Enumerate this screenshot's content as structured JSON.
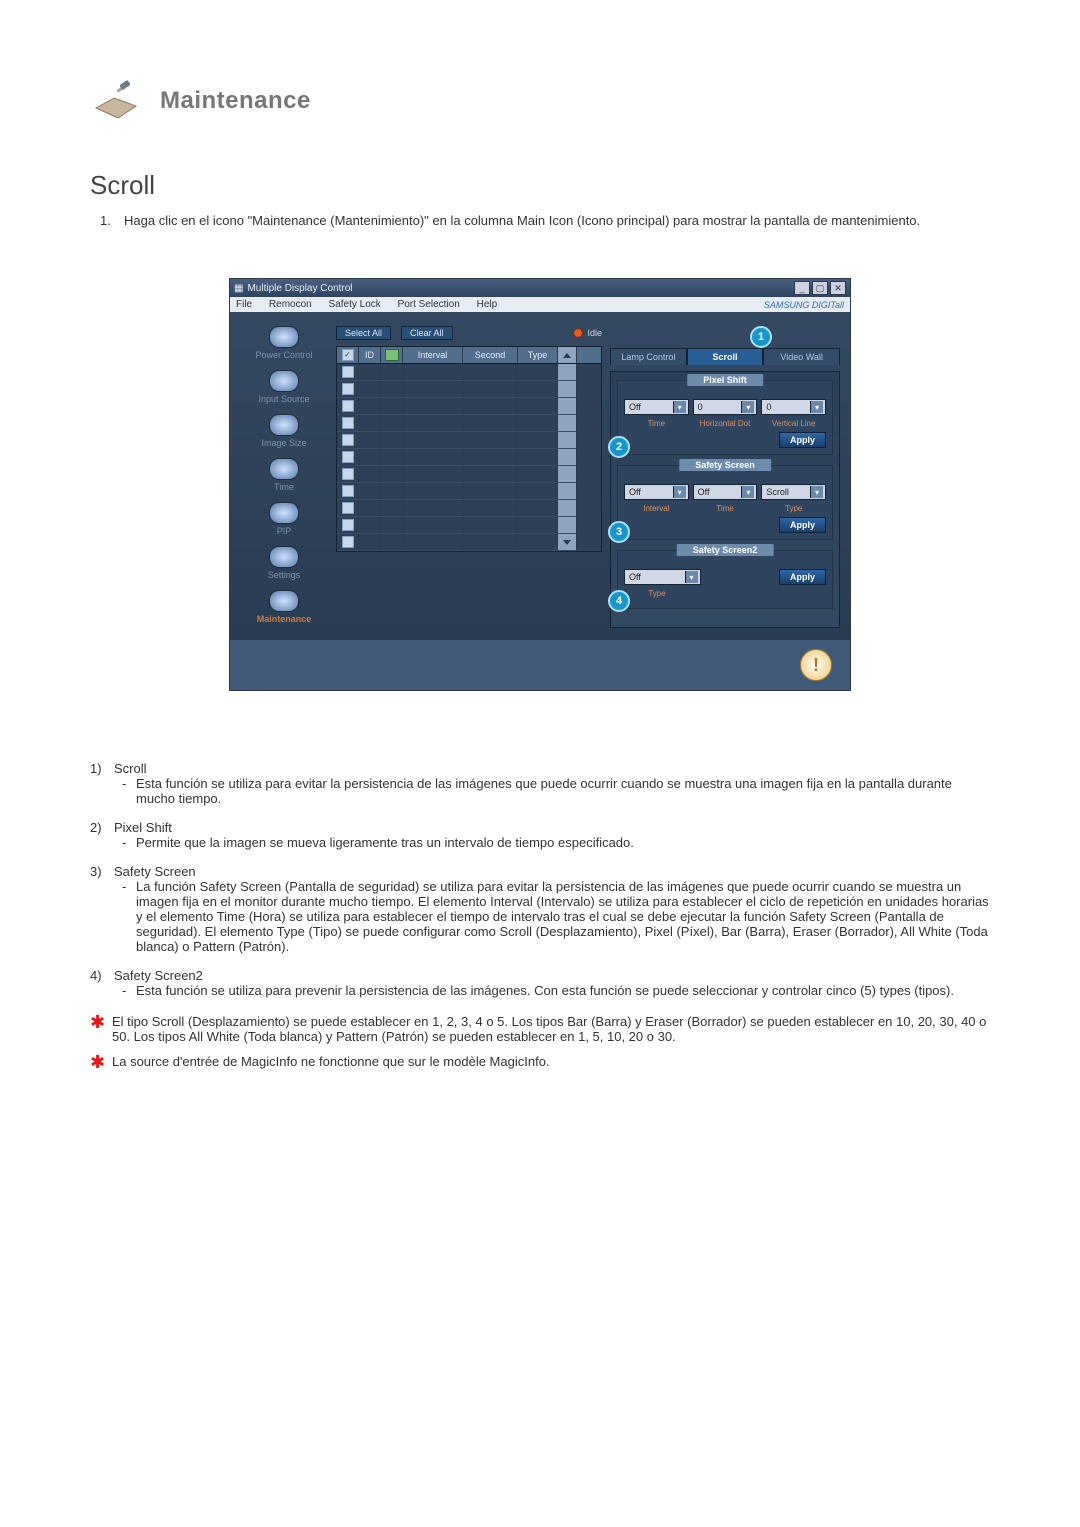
{
  "title": "Maintenance",
  "section": "Scroll",
  "intro": {
    "num": "1.",
    "text": "Haga clic en el icono \"Maintenance (Mantenimiento)\" en la columna Main Icon (Icono principal) para mostrar la pantalla de mantenimiento."
  },
  "window": {
    "title": "Multiple Display Control",
    "menu": [
      "File",
      "Remocon",
      "Safety Lock",
      "Port Selection",
      "Help"
    ],
    "brand": "SAMSUNG DIGITall"
  },
  "sidebar": [
    {
      "label": "Power Control"
    },
    {
      "label": "Input Source"
    },
    {
      "label": "Image Size"
    },
    {
      "label": "Time"
    },
    {
      "label": "PIP"
    },
    {
      "label": "Settings"
    },
    {
      "label": "Maintenance"
    }
  ],
  "mid": {
    "select_all": "Select All",
    "clear_all": "Clear All",
    "idle": "Idle",
    "headers": {
      "id": "ID",
      "interval": "Interval",
      "second": "Second",
      "type": "Type"
    }
  },
  "tabs": {
    "lamp": "Lamp Control",
    "scroll": "Scroll",
    "video": "Video Wall"
  },
  "callouts": {
    "one": "1",
    "two": "2",
    "three": "3",
    "four": "4"
  },
  "pixel_shift": {
    "title": "Pixel Shift",
    "time": "Off",
    "hdot": "0",
    "vline": "0",
    "sub_time": "Time",
    "sub_hdot": "Horizontal Dot",
    "sub_vline": "Vertical Line",
    "apply": "Apply"
  },
  "safety_screen": {
    "title": "Safety Screen",
    "interval": "Off",
    "time": "Off",
    "type": "Scroll",
    "sub_interval": "Interval",
    "sub_time": "Time",
    "sub_type": "Type",
    "apply": "Apply"
  },
  "safety_screen2": {
    "title": "Safety Screen2",
    "type": "Off",
    "sub_type": "Type",
    "apply": "Apply"
  },
  "defs": [
    {
      "num": "1)",
      "name": "Scroll",
      "dash": "-",
      "body": "Esta función se utiliza para evitar la persistencia de las imágenes que puede ocurrir cuando se muestra una imagen fija en la pantalla durante mucho tiempo."
    },
    {
      "num": "2)",
      "name": "Pixel Shift",
      "dash": "-",
      "body": "Permite que la imagen se mueva ligeramente tras un intervalo de tiempo especificado."
    },
    {
      "num": "3)",
      "name": "Safety Screen",
      "dash": "-",
      "body": "La función Safety Screen (Pantalla de seguridad) se utiliza para evitar la persistencia de las imágenes que puede ocurrir cuando se muestra un imagen fija en el monitor durante mucho tiempo.  El elemento Interval (Intervalo) se utiliza para establecer el ciclo de repetición en unidades horarias y el elemento Time (Hora) se utiliza para establecer el tiempo de intervalo tras el cual se debe ejecutar la función Safety Screen (Pantalla de seguridad). El elemento Type (Tipo) se puede configurar como Scroll (Desplazamiento), Pixel (Píxel), Bar (Barra), Eraser (Borrador), All White (Toda blanca) o Pattern (Patrón)."
    },
    {
      "num": "4)",
      "name": "Safety Screen2",
      "dash": "-",
      "body": "Esta función se utiliza para prevenir la persistencia de las imágenes. Con esta función se puede seleccionar y controlar cinco (5) types (tipos)."
    }
  ],
  "notes": [
    "El tipo Scroll (Desplazamiento) se puede establecer en 1, 2, 3, 4 o 5. Los tipos Bar (Barra) y Eraser (Borrador) se pueden establecer en 10, 20, 30, 40 o 50. Los tipos All White (Toda blanca) y Pattern (Patrón) se pueden establecer en 1, 5, 10, 20 o 30.",
    "La source d'entrée de MagicInfo ne fonctionne que sur le modèle MagicInfo."
  ]
}
